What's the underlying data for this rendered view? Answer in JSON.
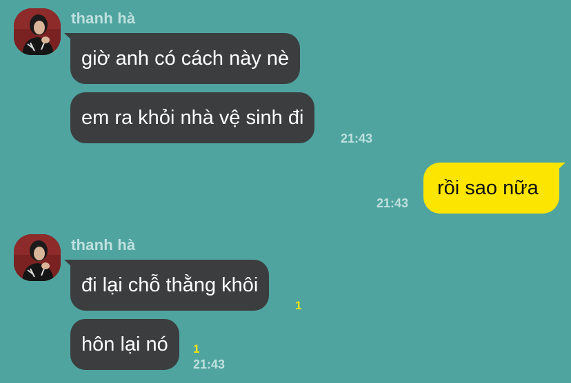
{
  "messages": {
    "group1": {
      "sender": "thanh hà",
      "bubble1": "giờ anh có cách này nè",
      "bubble2": "em ra khỏi nhà vệ sinh đi",
      "time": "21:43"
    },
    "mine1": {
      "text": "rồi sao nữa",
      "time": "21:43"
    },
    "group2": {
      "sender": "thanh hà",
      "bubble1": "đi lại chỗ thằng khôi",
      "bubble1_unread": "1",
      "bubble2": "hôn lại nó",
      "bubble2_unread": "1",
      "time": "21:43"
    }
  },
  "colors": {
    "background": "#4fa4a0",
    "incoming_bubble": "#3c3d3f",
    "outgoing_bubble": "#fce500",
    "unread_indicator": "#fce500"
  },
  "icons": {
    "avatar": "profile-photo"
  }
}
